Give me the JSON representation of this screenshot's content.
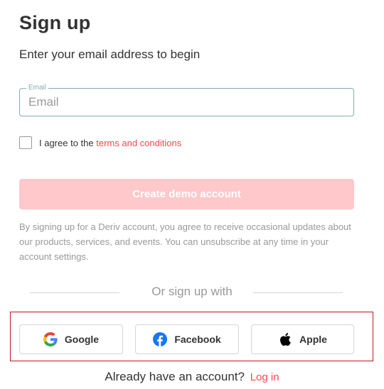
{
  "header": {
    "title": "Sign up",
    "subtitle": "Enter your email address to begin"
  },
  "email": {
    "legend": "Email",
    "placeholder": "Email",
    "value": ""
  },
  "agreement": {
    "prefix": "I agree to the",
    "link": "terms and conditions",
    "checked": false
  },
  "create_button": {
    "label": "Create demo account",
    "disabled": true
  },
  "disclaimer": "By signing up for a Deriv account, you agree to receive occasional updates about our products, services, and events. You can unsubscribe at any time in your account settings.",
  "social": {
    "divider": "Or sign up with",
    "buttons": [
      {
        "label": "Google",
        "icon": "google-icon"
      },
      {
        "label": "Facebook",
        "icon": "facebook-icon"
      },
      {
        "label": "Apple",
        "icon": "apple-icon"
      }
    ]
  },
  "footer": {
    "prompt": "Already have an account?",
    "link": "Log in"
  },
  "colors": {
    "accent": "#ff444f",
    "button_disabled": "#ffc8cb",
    "input_border": "#85acb0",
    "highlight": "#c4161c",
    "facebook": "#1877f2"
  }
}
